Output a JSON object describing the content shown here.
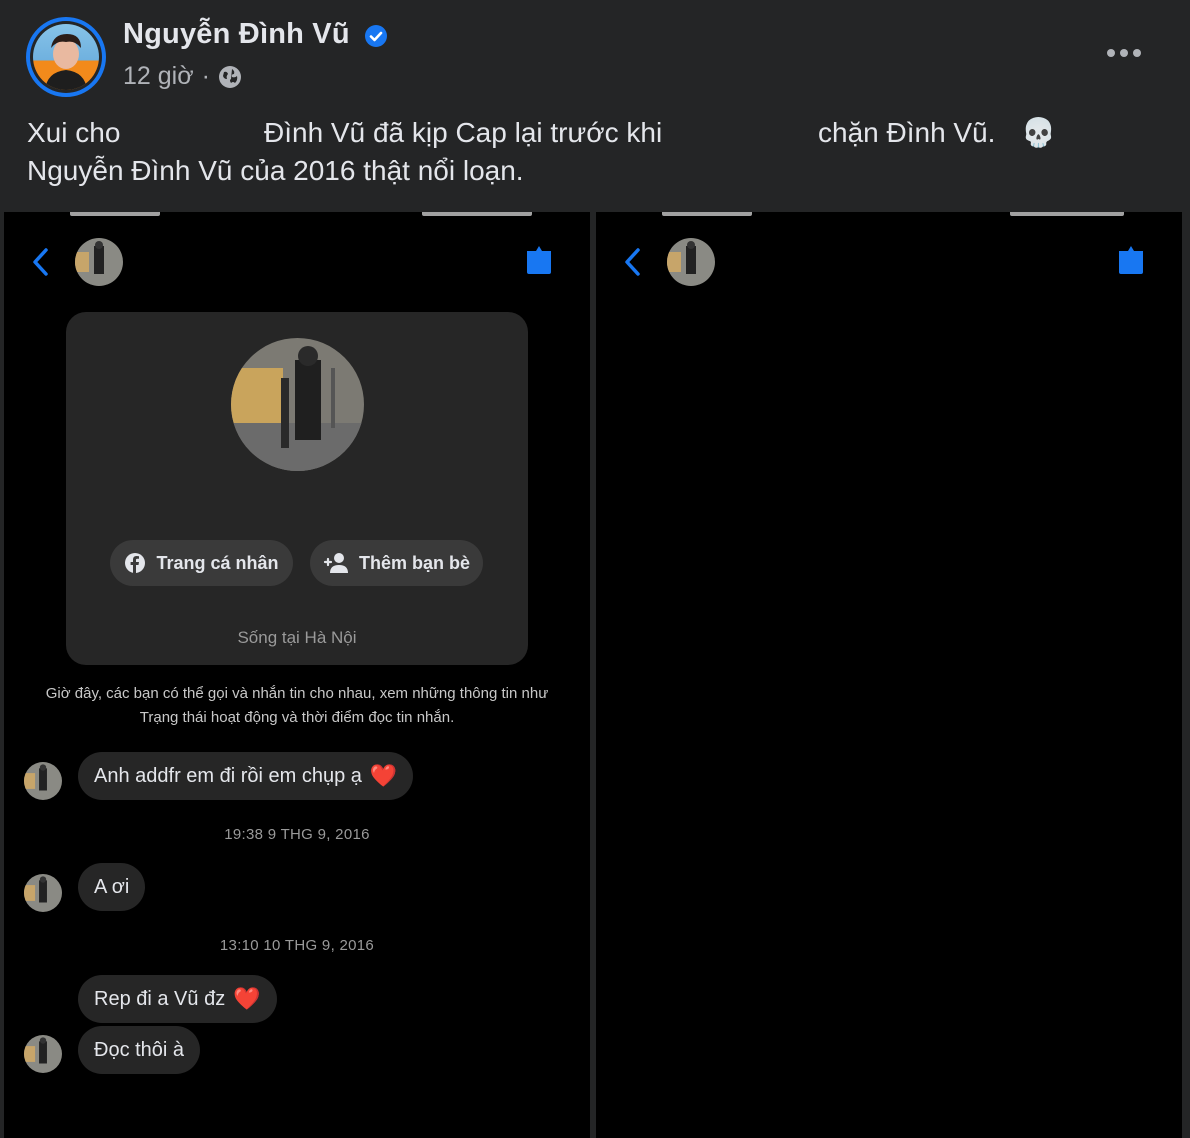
{
  "post": {
    "author": "Nguyễn Đình Vũ",
    "time": "12 giờ",
    "separator": "·",
    "caption_line1_a": "Xui cho",
    "caption_line1_b": "Đình Vũ đã kịp Cap lại trước khi",
    "caption_line1_c": "chặn Đình Vũ.",
    "caption_line1_emoji": "💀",
    "caption_line2": "Nguyễn Đình Vũ của 2016 thật nổi loạn."
  },
  "chat": {
    "profile_button": "Trang cá nhân",
    "add_friend_button": "Thêm bạn bè",
    "location": "Sống tại Hà Nội",
    "info_line1": "Giờ đây, các bạn có thể gọi và nhắn tin cho nhau, xem những thông tin như",
    "info_line2": "Trạng thái hoạt động và thời điểm đọc tin nhắn.",
    "messages": [
      {
        "text": "Anh addfr em đi rồi em chụp ạ",
        "emoji": "❤️"
      },
      {
        "timestamp": "19:38 9 THG 9, 2016"
      },
      {
        "text": "A ơi"
      },
      {
        "timestamp": "13:10 10 THG 9, 2016"
      },
      {
        "text": "Rep đi a Vũ đz",
        "emoji": "❤️"
      },
      {
        "text": "Đọc thôi à"
      }
    ]
  },
  "colors": {
    "accent": "#1877f2",
    "bubble": "#262626",
    "background": "#242526"
  }
}
